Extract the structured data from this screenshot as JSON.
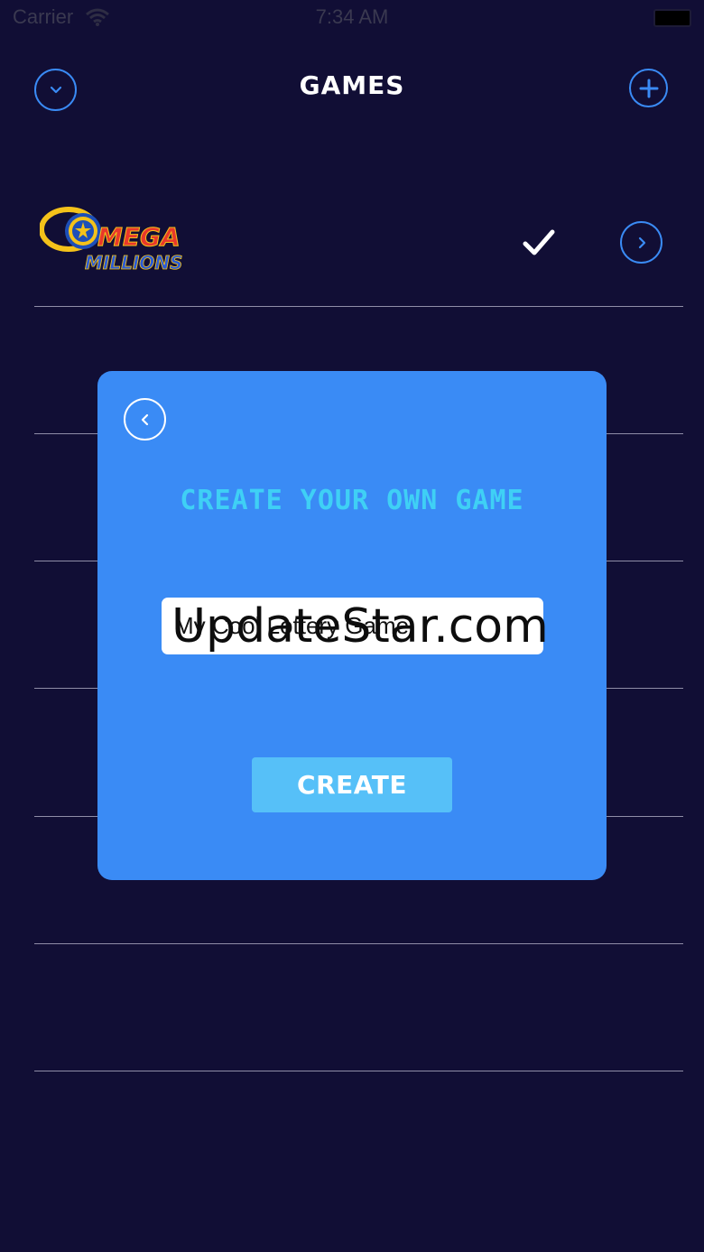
{
  "status_bar": {
    "carrier": "Carrier",
    "time": "7:34 AM"
  },
  "header": {
    "title": "GAMES",
    "left_icon": "chevron-down-icon",
    "right_icon": "plus-icon"
  },
  "games": [
    {
      "logo": "mega-millions-logo",
      "logo_text_top": "MEGA",
      "logo_text_bottom": "MILLIONS",
      "selected": true,
      "check_icon": "checkmark-icon",
      "action_icon": "chevron-right-icon"
    }
  ],
  "modal": {
    "back_icon": "chevron-left-icon",
    "title": "CREATE YOUR OWN GAME",
    "input_value": "My Cool Lottery Game",
    "create_label": "CREATE"
  },
  "watermark": "UpdateStar.com",
  "colors": {
    "background": "#110e35",
    "accent": "#3a8bf5",
    "modal_title": "#3fd0f5",
    "create_button": "#56c0f8",
    "separator": "#8f8da7"
  }
}
